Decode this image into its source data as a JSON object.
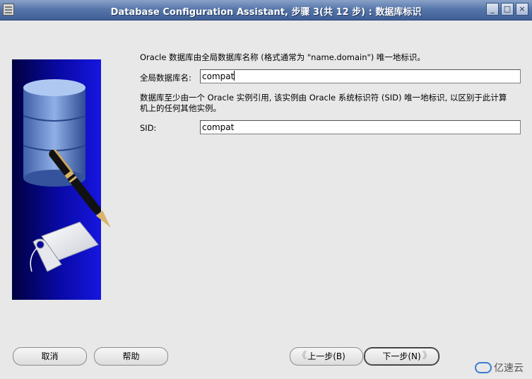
{
  "window": {
    "title": "Database Configuration Assistant, 步骤 3(共 12 步) : 数据库标识",
    "controls": {
      "minimize": "_",
      "maximize": "□",
      "close": "×"
    }
  },
  "form": {
    "intro_text": "Oracle 数据库由全局数据库名称 (格式通常为 \"name.domain\") 唯一地标识。",
    "global_db_name_label": "全局数据库名:",
    "global_db_name_value": "compat",
    "sid_desc_line1": "数据库至少由一个 Oracle 实例引用, 该实例由 Oracle 系统标识符 (SID) 唯一地标识, 以区别于此计算",
    "sid_desc_line2": "机上的任何其他实例。",
    "sid_label": "SID:",
    "sid_value": "compat"
  },
  "buttons": {
    "cancel": "取消",
    "help": "帮助",
    "back": "上一步(B)",
    "next": "下一步(N)",
    "back_arrow": "《",
    "next_arrow": "》"
  },
  "watermark": {
    "text": "亿速云"
  },
  "icons": [
    "app-icon",
    "minimize-icon",
    "maximize-icon",
    "close-icon",
    "database-pen-illustration"
  ],
  "colors": {
    "titlebar": "#5777aa",
    "art_panel": "#0a0aa8",
    "background": "#e8e8e8"
  }
}
